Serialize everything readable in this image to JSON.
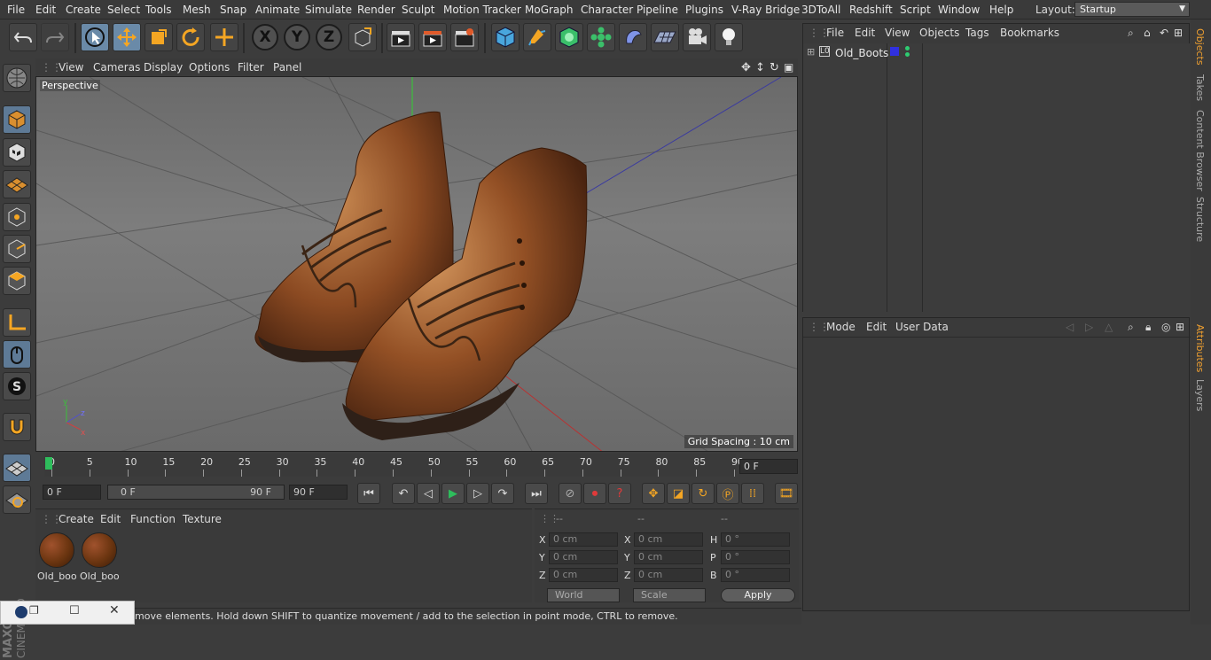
{
  "menubar": {
    "items": [
      "File",
      "Edit",
      "Create",
      "Select",
      "Tools",
      "Mesh",
      "Snap",
      "Animate",
      "Simulate",
      "Render",
      "Sculpt",
      "Motion Tracker",
      "MoGraph",
      "Character",
      "Pipeline",
      "Plugins",
      "V-Ray Bridge",
      "3DToAll",
      "Redshift",
      "Script",
      "Window",
      "Help"
    ],
    "layout_label": "Layout:",
    "layout_value": "Startup"
  },
  "viewport": {
    "menu": [
      "View",
      "Cameras",
      "Display",
      "Options",
      "Filter",
      "Panel"
    ],
    "label": "Perspective",
    "grid_spacing": "Grid Spacing : 10 cm"
  },
  "timeline": {
    "ticks": [
      "0",
      "5",
      "10",
      "15",
      "20",
      "25",
      "30",
      "35",
      "40",
      "45",
      "50",
      "55",
      "60",
      "65",
      "70",
      "75",
      "80",
      "85",
      "90"
    ],
    "current_frame": "0 F",
    "start": "0 F",
    "range_start": "0 F",
    "range_end": "90 F",
    "end": "90 F"
  },
  "materials": {
    "menu": [
      "Create",
      "Edit",
      "Function",
      "Texture"
    ],
    "items": [
      "Old_boo",
      "Old_boo"
    ]
  },
  "coords": {
    "headers": [
      "--",
      "--",
      "--"
    ],
    "rows": [
      {
        "pos_label": "X",
        "pos": "0 cm",
        "size_label": "X",
        "size": "0 cm",
        "rot_label": "H",
        "rot": "0 °"
      },
      {
        "pos_label": "Y",
        "pos": "0 cm",
        "size_label": "Y",
        "size": "0 cm",
        "rot_label": "P",
        "rot": "0 °"
      },
      {
        "pos_label": "Z",
        "pos": "0 cm",
        "size_label": "Z",
        "size": "0 cm",
        "rot_label": "B",
        "rot": "0 °"
      }
    ],
    "space": "World",
    "mode": "Scale",
    "apply": "Apply"
  },
  "objects": {
    "menu": [
      "File",
      "Edit",
      "View",
      "Objects",
      "Tags",
      "Bookmarks"
    ],
    "item": "Old_Boots"
  },
  "attributes": {
    "menu": [
      "Mode",
      "Edit",
      "User Data"
    ]
  },
  "right_tabs": [
    "Objects",
    "Takes",
    "Content Browser",
    "Structure"
  ],
  "right_tabs2": [
    "Attributes",
    "Layers"
  ],
  "status": "move elements. Hold down SHIFT to quantize movement / add to the selection in point mode, CTRL to remove.",
  "brand": {
    "top": "MAXON",
    "bottom": "CINEMA 4D"
  },
  "colors": {
    "bg": "#3c3c3c",
    "accent": "#f0a030",
    "brown": "#8b4a22"
  }
}
